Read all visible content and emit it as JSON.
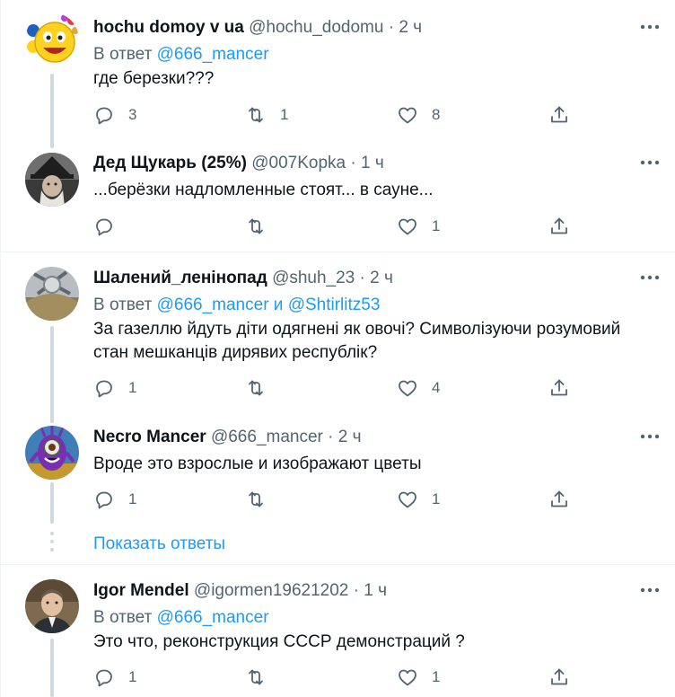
{
  "tweets": [
    {
      "name": "hochu domoy v ua",
      "handle": "@hochu_dodomu",
      "time": "2 ч",
      "reply_label": "В ответ",
      "reply_mentions": "@666_mancer",
      "text": "где березки???",
      "replies": "3",
      "retweets": "1",
      "likes": "8"
    },
    {
      "name": "Дед Щукарь (25%)",
      "handle": "@007Kopka",
      "time": "1 ч",
      "text": "...берёзки надломленные стоят... в сауне...",
      "replies": "",
      "retweets": "",
      "likes": "1"
    },
    {
      "name": "Шалений_ленінопад",
      "handle": "@shuh_23",
      "time": "2 ч",
      "reply_label": "В ответ",
      "reply_mentions": "@666_mancer и @Shtirlitz53",
      "text": "За газеллю йдуть діти одягнені як овочі? Символізуючи розумовий стан мешканців дирявих республік?",
      "replies": "1",
      "retweets": "",
      "likes": "4"
    },
    {
      "name": "Necro Mancer",
      "handle": "@666_mancer",
      "time": "2 ч",
      "text": "Вроде это взрослые и изображают цветы",
      "replies": "1",
      "retweets": "",
      "likes": "1"
    },
    {
      "name": "Igor Mendel",
      "handle": "@igormen19621202",
      "time": "1 ч",
      "reply_label": "В ответ",
      "reply_mentions": "@666_mancer",
      "text": "Это что, реконструкция СССР демонстраций ?",
      "replies": "1",
      "retweets": "",
      "likes": "1"
    }
  ],
  "show_replies": "Показать ответы",
  "separator": "·",
  "icons": {
    "reply": "reply-icon",
    "retweet": "retweet-icon",
    "like": "heart-icon",
    "share": "share-icon",
    "more": "more-icon"
  },
  "colors": {
    "link": "#1d9bf0",
    "secondary": "#536471",
    "text": "#0f1419",
    "thread_line": "#cfd9de"
  }
}
